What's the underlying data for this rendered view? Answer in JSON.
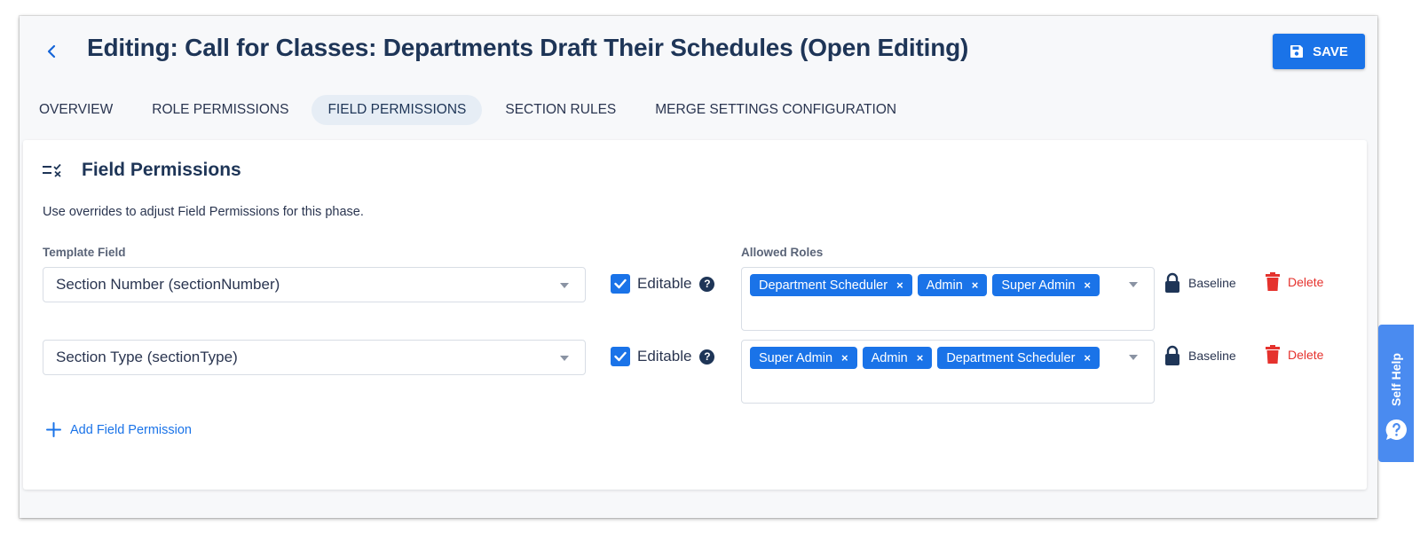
{
  "header": {
    "title": "Editing: Call for Classes: Departments Draft Their Schedules (Open Editing)",
    "save_label": "SAVE"
  },
  "tabs": [
    {
      "label": "OVERVIEW",
      "active": false
    },
    {
      "label": "ROLE PERMISSIONS",
      "active": false
    },
    {
      "label": "FIELD PERMISSIONS",
      "active": true
    },
    {
      "label": "SECTION RULES",
      "active": false
    },
    {
      "label": "MERGE SETTINGS CONFIGURATION",
      "active": false
    }
  ],
  "card": {
    "title": "Field Permissions",
    "description": "Use overrides to adjust Field Permissions for this phase.",
    "template_field_label": "Template Field",
    "allowed_roles_label": "Allowed Roles",
    "add_label": "Add Field Permission"
  },
  "rows": [
    {
      "field": "Section Number (sectionNumber)",
      "editable_label": "Editable",
      "editable_checked": true,
      "roles": [
        "Department Scheduler",
        "Admin",
        "Super Admin"
      ],
      "baseline_label": "Baseline",
      "delete_label": "Delete"
    },
    {
      "field": "Section Type (sectionType)",
      "editable_label": "Editable",
      "editable_checked": true,
      "roles": [
        "Super Admin",
        "Admin",
        "Department Scheduler"
      ],
      "baseline_label": "Baseline",
      "delete_label": "Delete"
    }
  ],
  "self_help": {
    "label": "Self Help"
  },
  "colors": {
    "primary": "#1a73e8",
    "title": "#1e3557",
    "danger": "#e5322d",
    "tab_active_bg": "#e6edf5"
  },
  "icons": {
    "back": "chevron-left-icon",
    "save": "floppy-disk-icon",
    "section": "list-check-icon",
    "help": "question-circle-icon",
    "baseline": "lock-icon",
    "delete": "trash-icon",
    "add": "plus-icon",
    "self_help": "question-bubble-icon"
  }
}
